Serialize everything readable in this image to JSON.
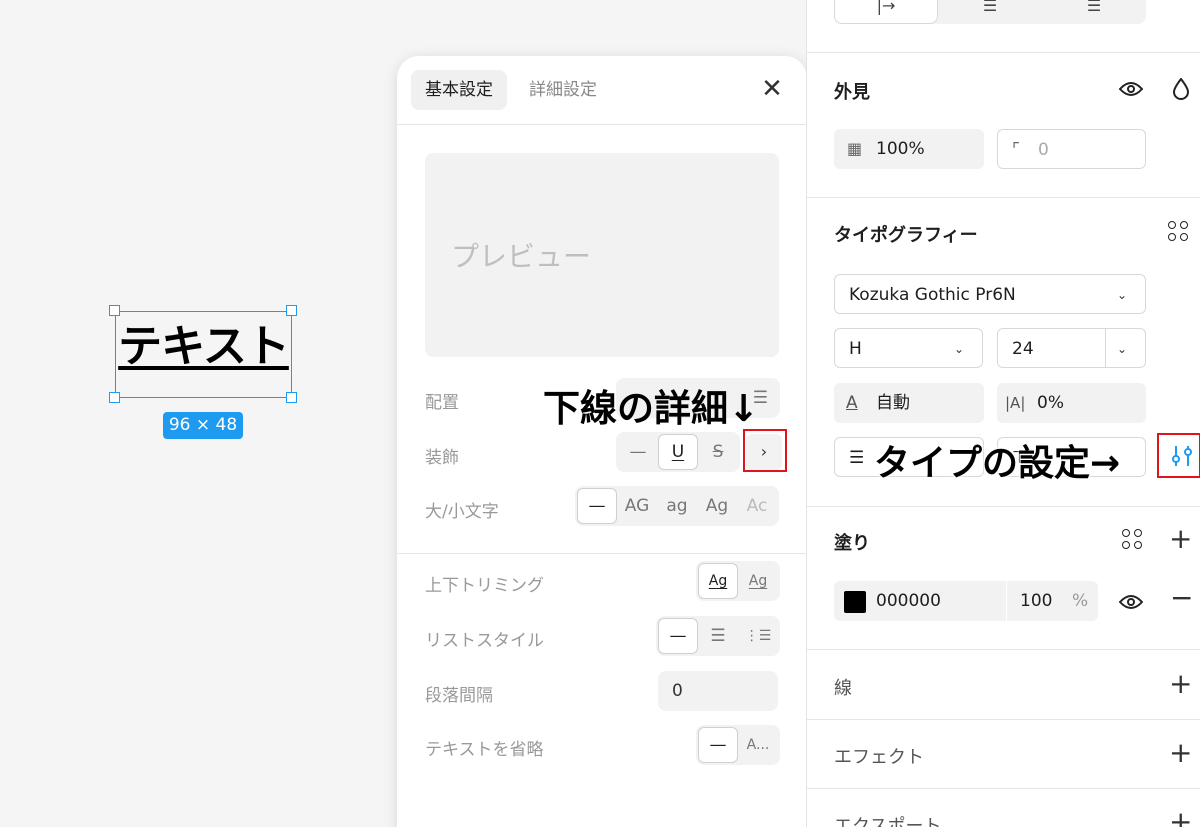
{
  "canvas": {
    "text": "テキスト",
    "size_label": "96 × 48"
  },
  "popover": {
    "tabs": [
      "基本設定",
      "詳細設定"
    ],
    "close_glyph": "✕",
    "preview_text": "プレビュー",
    "rows": {
      "alignment_label": "配置",
      "decoration_label": "装飾",
      "case_label": "大/小文字",
      "trim_label": "上下トリミング",
      "list_label": "リストスタイル",
      "paragraph_label": "段落間隔",
      "truncate_label": "テキストを省略"
    },
    "decoration_options": [
      "—",
      "U",
      "S"
    ],
    "decoration_more": "›",
    "case_options": [
      "—",
      "AG",
      "ag",
      "Ag",
      "Ac"
    ],
    "trim_options": [
      "Ag",
      "Ag"
    ],
    "list_options": [
      "—",
      "☰",
      "⋮☰"
    ],
    "paragraph_value": "0",
    "truncate_options": [
      "—",
      "A..."
    ]
  },
  "panel": {
    "appearance_title": "外見",
    "opacity": "100%",
    "radius": "0",
    "typography_title": "タイポグラフィー",
    "font_family": "Kozuka Gothic Pr6N",
    "font_weight": "H",
    "font_size": "24",
    "line_height": "自動",
    "letter_spacing": "0%",
    "fill_title": "塗り",
    "fill_hex": "000000",
    "fill_opacity": "100",
    "fill_percent": "%",
    "stroke_title": "線",
    "effect_title": "エフェクト",
    "export_title": "エクスポート"
  },
  "annotations": {
    "underline_detail": "下線の詳細↓",
    "type_settings": "タイプの設定→"
  },
  "colors": {
    "selection": "#1e9bf0",
    "highlight": "#e0141b",
    "fill_swatch": "#000000"
  }
}
